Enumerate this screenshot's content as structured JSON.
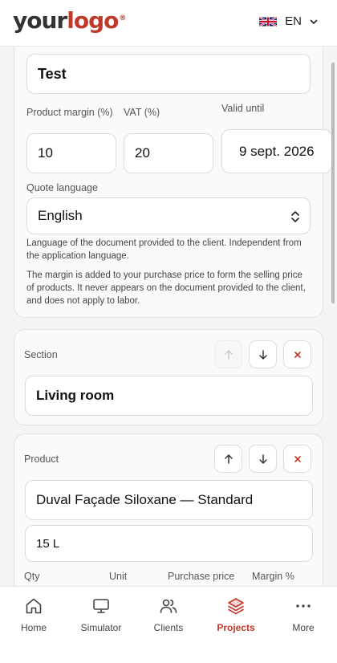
{
  "header": {
    "logo": {
      "your": "your",
      "brand": "logo",
      "reg": "®"
    },
    "language": {
      "flag_icon": "uk-flag-icon",
      "code": "EN"
    }
  },
  "quote": {
    "name_value": "Test",
    "product_margin_label": "Product margin (%)",
    "vat_label": "VAT (%)",
    "valid_until_label": "Valid until",
    "product_margin_value": "10",
    "vat_value": "20",
    "valid_until_value": "9 sept. 2026",
    "quote_language_label": "Quote language",
    "quote_language_value": "English",
    "language_help": "Language of the document provided to the client. Independent from the application language.",
    "margin_help": "The margin is added to your purchase price to form the selling price of products. It never appears on the document provided to the client, and does not apply to labor."
  },
  "section": {
    "label": "Section",
    "name_value": "Living room"
  },
  "product": {
    "label": "Product",
    "name_value": "Duval Façade Siloxane — Standard",
    "size_value": "15 L",
    "columns": [
      "Qty",
      "Unit",
      "Purchase price",
      "Margin %"
    ]
  },
  "nav": {
    "items": [
      {
        "label": "Home",
        "icon": "home-icon"
      },
      {
        "label": "Simulator",
        "icon": "monitor-icon"
      },
      {
        "label": "Clients",
        "icon": "users-icon"
      },
      {
        "label": "Projects",
        "icon": "layers-icon",
        "active": true
      },
      {
        "label": "More",
        "icon": "more-icon"
      }
    ]
  },
  "colors": {
    "accent": "#c0392b",
    "card_bg": "#fafafa",
    "border": "#dcdce0"
  }
}
